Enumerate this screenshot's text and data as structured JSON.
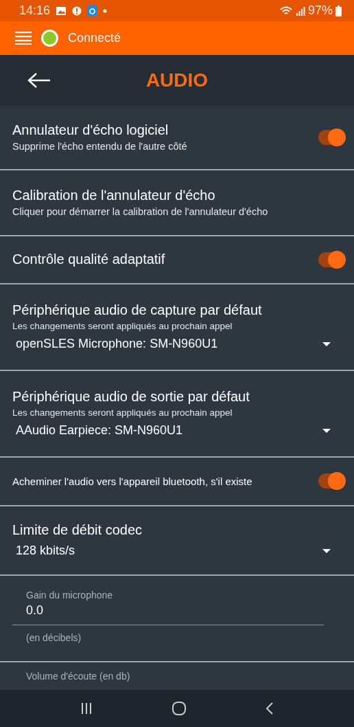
{
  "status_bar": {
    "time": "14:16",
    "battery": "97%"
  },
  "app_bar": {
    "connection": "Connecté",
    "connected": true
  },
  "header": {
    "title": "AUDIO"
  },
  "settings": [
    {
      "kind": "toggle",
      "title": "Annulateur d'écho logiciel",
      "subtitle": "Supprime l'écho entendu de l'autre côté",
      "on": true
    },
    {
      "kind": "action",
      "title": "Calibration de l'annulateur d'écho",
      "subtitle": "Cliquer pour démarrer la calibration de l'annulateur d'écho"
    },
    {
      "kind": "toggle",
      "title": "Contrôle qualité adaptatif",
      "on": true
    },
    {
      "kind": "select",
      "title": "Périphérique audio de capture par défaut",
      "subtitle": "Les changements seront appliqués au prochain appel",
      "value": "openSLES Microphone: SM-N960U1"
    },
    {
      "kind": "select",
      "title": "Périphérique audio de sortie par défaut",
      "subtitle": "Les changements seront appliqués au prochain appel",
      "value": "AAudio Earpiece: SM-N960U1"
    },
    {
      "kind": "toggle_small",
      "title": "Acheminer l'audio vers l'appareil bluetooth, s'il existe",
      "on": true
    },
    {
      "kind": "select",
      "title": "Limite de débit codec",
      "value": "128 kbits/s"
    },
    {
      "kind": "field",
      "label": "Gain du microphone",
      "value": "0.0",
      "helper": "(en décibels)"
    },
    {
      "kind": "field_partial",
      "label": "Volume d'écoute (en db)"
    }
  ]
}
